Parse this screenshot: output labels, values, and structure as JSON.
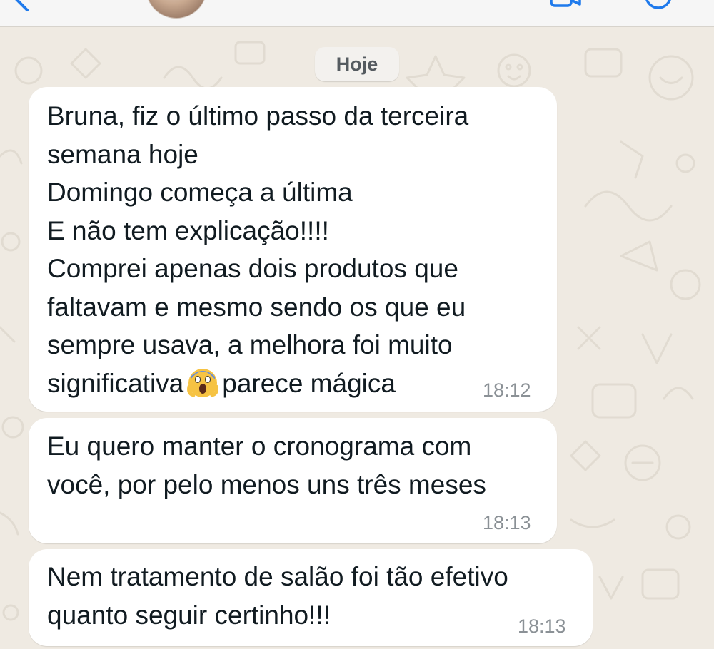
{
  "header": {
    "back_icon": "chevron-left-icon",
    "video_icon": "video-camera-icon",
    "call_icon": "phone-icon"
  },
  "date_separator": "Hoje",
  "messages": [
    {
      "lines": [
        "Bruna, fiz o último passo da terceira",
        "semana hoje",
        "Domingo começa a última",
        "E não tem explicação!!!!",
        "Comprei apenas dois produtos que",
        "faltavam e mesmo sendo os que eu",
        "sempre usava, a melhora foi muito"
      ],
      "last_line_before_emoji": "significativa",
      "emoji": "😱",
      "last_line_after_emoji": "parece mágica",
      "time": "18:12"
    },
    {
      "lines": [
        "Eu quero manter o cronograma com",
        "você, por pelo menos uns três meses"
      ],
      "time": "18:13"
    },
    {
      "lines": [
        "Nem tratamento de salão foi tão efetivo",
        "quanto seguir certinho!!!"
      ],
      "time": "18:13"
    }
  ],
  "colors": {
    "wallpaper": "#efeae2",
    "bubble": "#ffffff",
    "time": "#8b9196",
    "accent": "#1f7aec"
  }
}
